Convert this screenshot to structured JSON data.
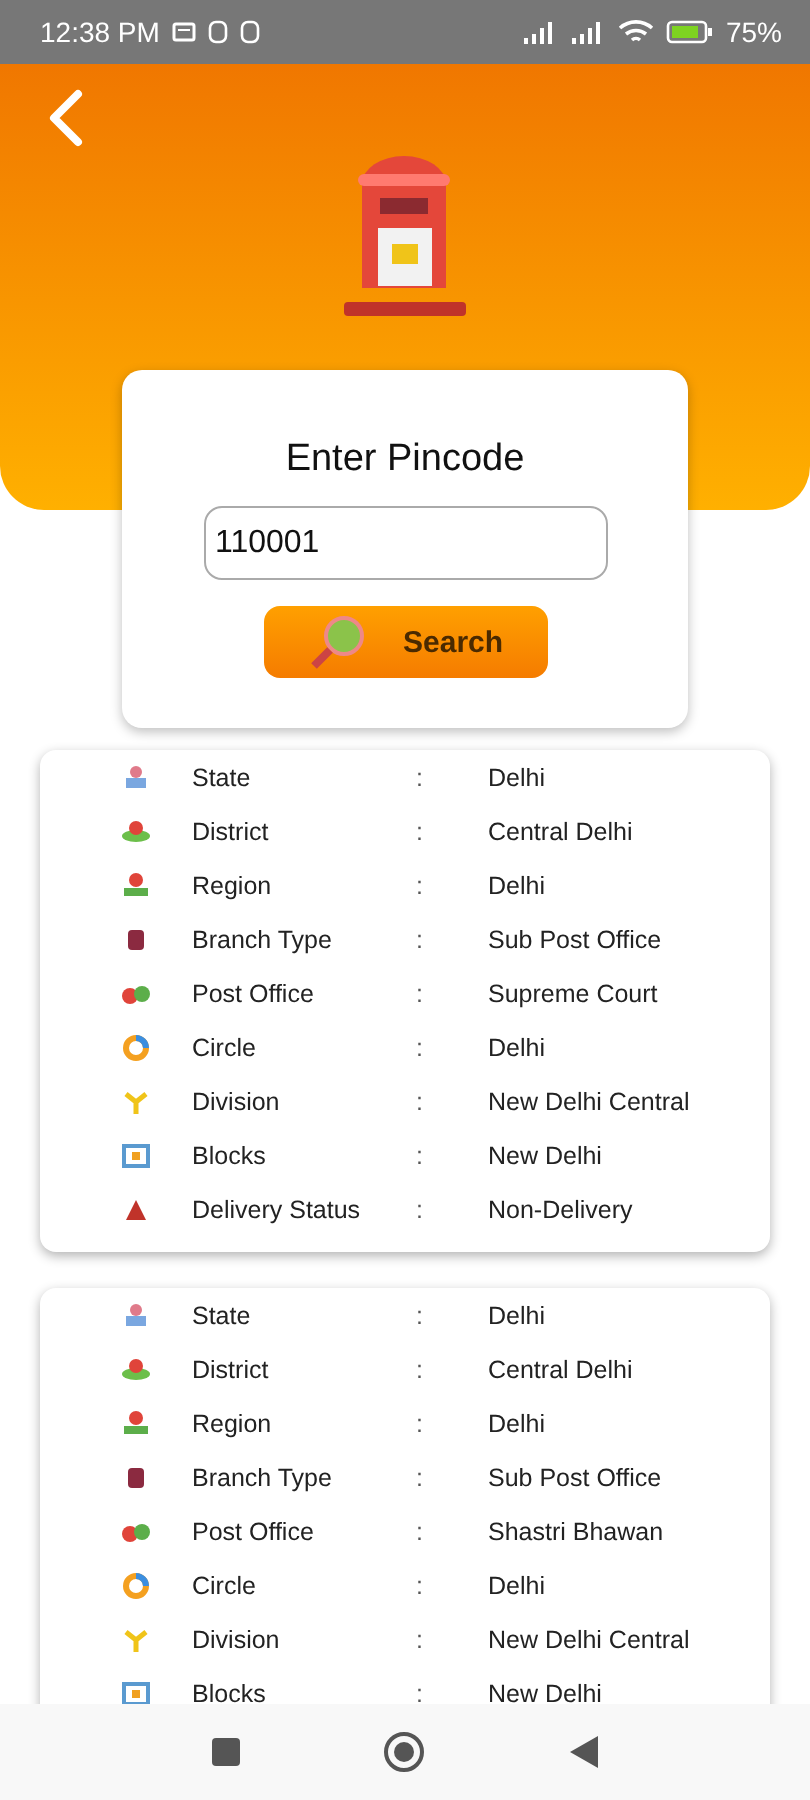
{
  "status_bar": {
    "time": "12:38 PM",
    "battery": "75%"
  },
  "search_card": {
    "title": "Enter Pincode",
    "pincode": "110001",
    "button": "Search"
  },
  "results": [
    {
      "rows": [
        {
          "label": "State",
          "separator": ":",
          "value": "Delhi"
        },
        {
          "label": "District",
          "separator": ":",
          "value": "Central Delhi"
        },
        {
          "label": "Region",
          "separator": ":",
          "value": "Delhi"
        },
        {
          "label": "Branch Type",
          "separator": ":",
          "value": "Sub Post Office"
        },
        {
          "label": "Post Office",
          "separator": ":",
          "value": "Supreme Court"
        },
        {
          "label": "Circle",
          "separator": ":",
          "value": "Delhi"
        },
        {
          "label": "Division",
          "separator": ":",
          "value": "New Delhi Central"
        },
        {
          "label": "Blocks",
          "separator": ":",
          "value": "New Delhi"
        },
        {
          "label": "Delivery Status",
          "separator": ":",
          "value": "Non-Delivery"
        }
      ]
    },
    {
      "rows": [
        {
          "label": "State",
          "separator": ":",
          "value": "Delhi"
        },
        {
          "label": "District",
          "separator": ":",
          "value": "Central Delhi"
        },
        {
          "label": "Region",
          "separator": ":",
          "value": "Delhi"
        },
        {
          "label": "Branch Type",
          "separator": ":",
          "value": "Sub Post Office"
        },
        {
          "label": "Post Office",
          "separator": ":",
          "value": "Shastri Bhawan"
        },
        {
          "label": "Circle",
          "separator": ":",
          "value": "Delhi"
        },
        {
          "label": "Division",
          "separator": ":",
          "value": "New Delhi Central"
        },
        {
          "label": "Blocks",
          "separator": ":",
          "value": "New Delhi"
        }
      ]
    }
  ]
}
